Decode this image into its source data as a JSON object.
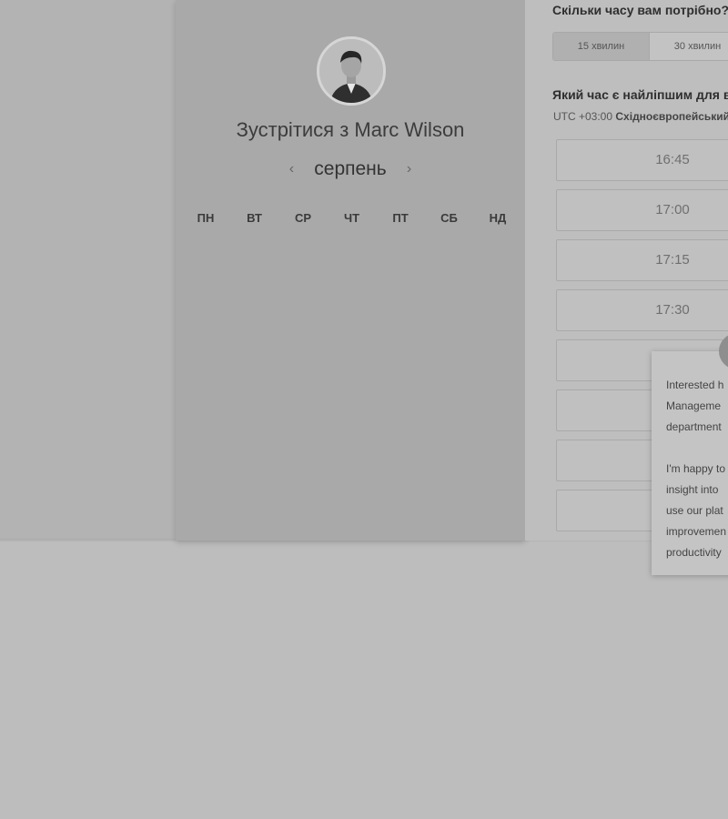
{
  "host": {
    "title": "Зустрітися з Marc Wilson",
    "month": "серпень",
    "prev_arrow": "‹",
    "next_arrow": "›",
    "weekdays": [
      "ПН",
      "ВТ",
      "СР",
      "ЧТ",
      "ПТ",
      "СБ",
      "НД"
    ]
  },
  "schedule": {
    "duration_question": "Скільки часу вам потрібно?",
    "durations": [
      "15 хвилин",
      "30 хвилин"
    ],
    "time_question": "Який час є найліпшим для вас?",
    "timezone_prefix": "UTC +03:00",
    "timezone_name": "Східноєвропейський час",
    "slots": [
      "16:45",
      "17:00",
      "17:15",
      "17:30",
      "",
      "",
      "",
      ""
    ]
  },
  "chat": {
    "message": "Interested h\nManageme\ndepartment\n\nI'm happy to\ninsight into\nuse our plat\nimprovemen\nproductivity"
  }
}
